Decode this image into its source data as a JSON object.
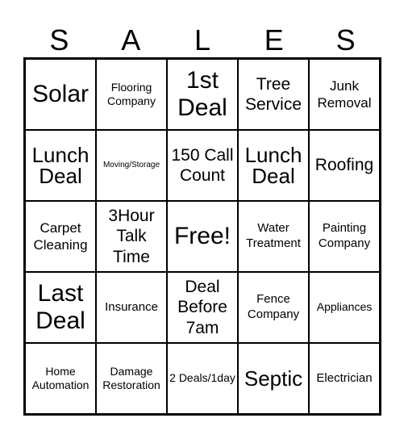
{
  "header": {
    "letters": [
      "S",
      "A",
      "L",
      "E",
      "S"
    ]
  },
  "cells": [
    [
      "Solar",
      "Flooring Company",
      "1st Deal",
      "Tree Service",
      "Junk Removal"
    ],
    [
      "Lunch Deal",
      "Moving/Storage",
      "150 Call Count",
      "Lunch Deal",
      "Roofing"
    ],
    [
      "Carpet Cleaning",
      "3Hour Talk Time",
      "Free!",
      "Water Treatment",
      "Painting Company"
    ],
    [
      "Last Deal",
      "Insurance",
      "Deal Before 7am",
      "Fence Company",
      "Appliances"
    ],
    [
      "Home Automation",
      "Damage Restoration",
      "2 Deals/1day",
      "Septic",
      "Electrician"
    ]
  ]
}
